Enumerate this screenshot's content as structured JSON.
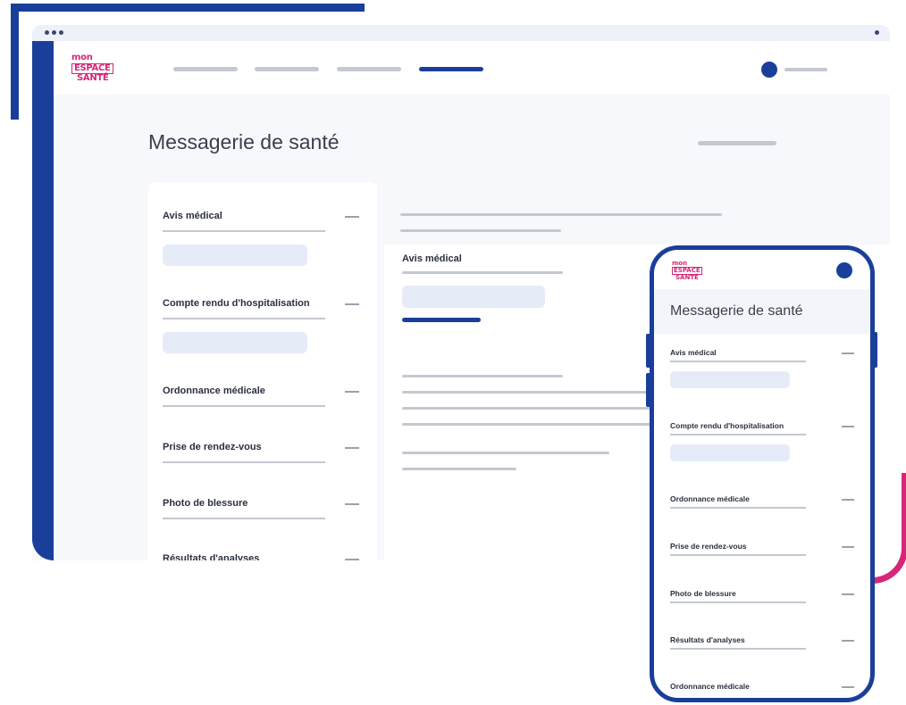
{
  "desktop": {
    "title": "Messagerie de santé",
    "categories": [
      {
        "label": "Avis médical"
      },
      {
        "label": "Compte rendu d'hospitalisation"
      },
      {
        "label": "Ordonnance médicale"
      },
      {
        "label": "Prise de rendez-vous"
      },
      {
        "label": "Photo de blessure"
      },
      {
        "label": "Résultats d'analyses"
      }
    ],
    "detail": {
      "subtitle": "Avis médical"
    }
  },
  "mobile": {
    "title": "Messagerie de santé",
    "categories": [
      {
        "label": "Avis médical"
      },
      {
        "label": "Compte rendu d'hospitalisation"
      },
      {
        "label": "Ordonnance médicale"
      },
      {
        "label": "Prise de rendez-vous"
      },
      {
        "label": "Photo de blessure"
      },
      {
        "label": "Résultats d'analyses"
      },
      {
        "label": "Ordonnance médicale"
      }
    ]
  },
  "brand": {
    "logo_line1": "mon",
    "logo_line2": "ESPACE",
    "logo_line3": "SANTÉ"
  },
  "colors": {
    "primary": "#1a3f9a",
    "accent": "#d6267a",
    "placeholder": "#c4c8d2",
    "pill": "#e6ebf8"
  }
}
